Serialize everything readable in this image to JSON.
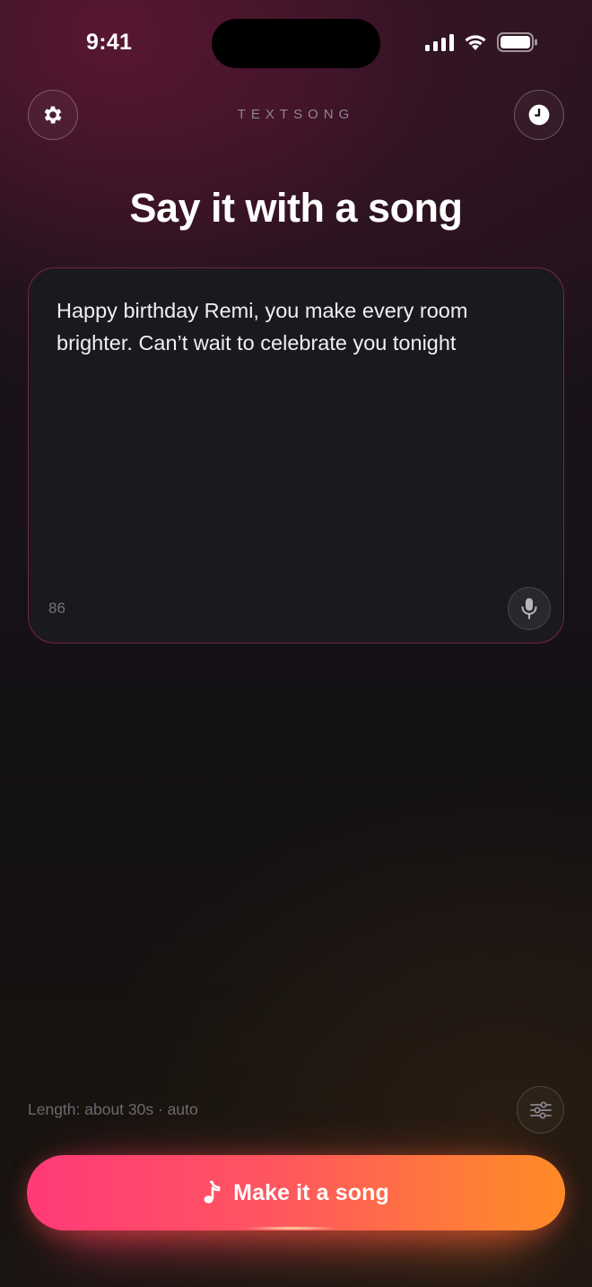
{
  "status_bar": {
    "time": "9:41",
    "icons": [
      "cellular-signal-icon",
      "wifi-icon",
      "battery-icon"
    ]
  },
  "header": {
    "brand": "TEXTSONG",
    "left_icon": "gear-icon",
    "right_icon": "clock-icon"
  },
  "main": {
    "title": "Say it with a song",
    "message": {
      "value": "Happy birthday Remi, you make every room brighter. Can’t wait to celebrate you tonight",
      "char_count": "86",
      "mic_icon": "microphone-icon"
    }
  },
  "footer": {
    "length_label": "Length: about 30s · auto",
    "options_icon": "sliders-icon",
    "cta_label": "Make it a song",
    "cta_icon": "music-note-icon"
  },
  "colors": {
    "accent_start": "#ff3a78",
    "accent_end": "#ff8a26",
    "card_border": "#be2d6e"
  }
}
